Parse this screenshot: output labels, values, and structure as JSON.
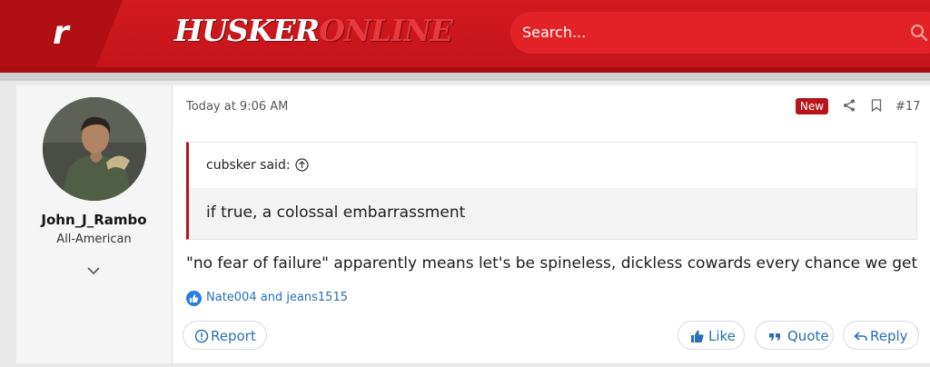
{
  "header": {
    "logo_letter": "r",
    "site_name_part1": "HUSKER",
    "site_name_part2": "ONLINE",
    "search_placeholder": "Search...",
    "colors": {
      "brand_red": "#c8161c",
      "search_bg": "#e32227"
    }
  },
  "post": {
    "author": {
      "name": "John_J_Rambo",
      "title": "All-American"
    },
    "timestamp": "Today at 9:06 AM",
    "badge": "New",
    "number": "#17",
    "quote": {
      "author_label": "cubsker said:",
      "text": "if true, a colossal embarrassment"
    },
    "message": "\"no fear of failure\" apparently means let's be spineless, dickless cowards every chance we get",
    "reactions": {
      "users": "Nate004 and jeans1515",
      "icon": "like-reaction-icon"
    },
    "actions": {
      "report": "Report",
      "like": "Like",
      "quote": "Quote",
      "reply": "Reply"
    },
    "colors": {
      "link": "#2a6ebf",
      "accent": "#b8141a"
    }
  }
}
